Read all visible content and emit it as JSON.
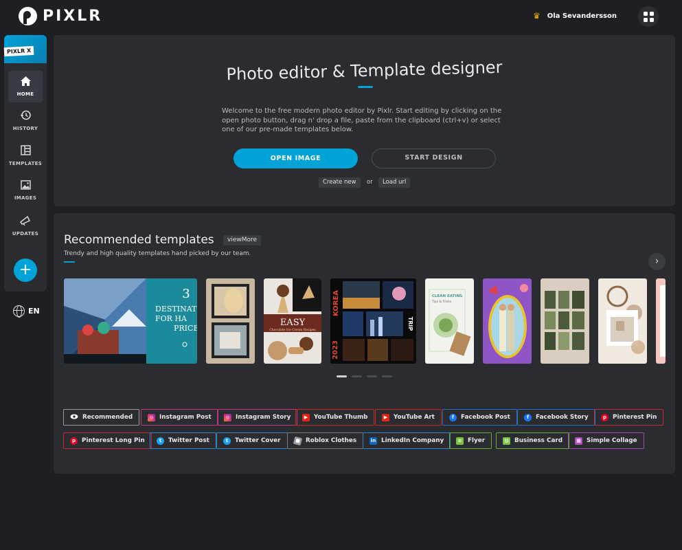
{
  "brand": {
    "name": "PIXLR"
  },
  "header": {
    "user_name": "Ola Sevandersson"
  },
  "sidebar": {
    "banner_label": "PIXLR X",
    "items": [
      {
        "label": "HOME",
        "icon": "home-icon"
      },
      {
        "label": "HISTORY",
        "icon": "history-icon"
      },
      {
        "label": "TEMPLATES",
        "icon": "templates-icon"
      },
      {
        "label": "IMAGES",
        "icon": "images-icon"
      },
      {
        "label": "UPDATES",
        "icon": "updates-icon"
      }
    ],
    "add_label": "+",
    "language": "EN"
  },
  "hero": {
    "title": "Photo editor & Template designer",
    "description": "Welcome to the free modern photo editor by Pixlr. Start editing by clicking on the open photo button, drag n' drop a file, paste from the clipboard (ctrl+v) or select one of our pre-made templates below.",
    "open_image": "OPEN IMAGE",
    "start_design": "START DESIGN",
    "create_new": "Create new",
    "or": "or",
    "load_url": "Load url"
  },
  "templates": {
    "title": "Recommended templates",
    "view_more": "viewMore",
    "subtitle": "Trendy and high quality templates hand picked by our team.",
    "thumb1_text": {
      "number": "3",
      "line1": "DESTINATI",
      "line2": "FOR HA",
      "line3": "PRICE"
    },
    "thumb3_text": {
      "big": "EASY",
      "small": "Chocolate Ice Cream Recipes"
    },
    "thumb4_text": {
      "korea": "KOREA",
      "trip": "TRIP",
      "year": "2023"
    },
    "thumb5_text": {
      "line1": "CLEAN EATING",
      "line2": "Tips & Tricks"
    }
  },
  "categories": [
    {
      "label": "Recommended",
      "color": "#cfcfcf"
    },
    {
      "label": "Instagram Post",
      "color": "#c13584"
    },
    {
      "label": "Instagram Story",
      "color": "#c13584"
    },
    {
      "label": "YouTube Thumb",
      "color": "#e62117"
    },
    {
      "label": "YouTube Art",
      "color": "#e62117"
    },
    {
      "label": "Facebook Post",
      "color": "#1877f2"
    },
    {
      "label": "Facebook Story",
      "color": "#1877f2"
    },
    {
      "label": "Pinterest Pin",
      "color": "#e60023"
    },
    {
      "label": "Pinterest Long Pin",
      "color": "#e60023"
    },
    {
      "label": "Twitter Post",
      "color": "#1da1f2"
    },
    {
      "label": "Twitter Cover",
      "color": "#1da1f2"
    },
    {
      "label": "Roblox Clothes",
      "color": "#9a9a9a"
    },
    {
      "label": "LinkedIn Company",
      "color": "#2d8fd5"
    },
    {
      "label": "Flyer",
      "color": "#7cc242"
    },
    {
      "label": "Business Card",
      "color": "#7cc242"
    },
    {
      "label": "Simple Collage",
      "color": "#b04fc0"
    }
  ]
}
